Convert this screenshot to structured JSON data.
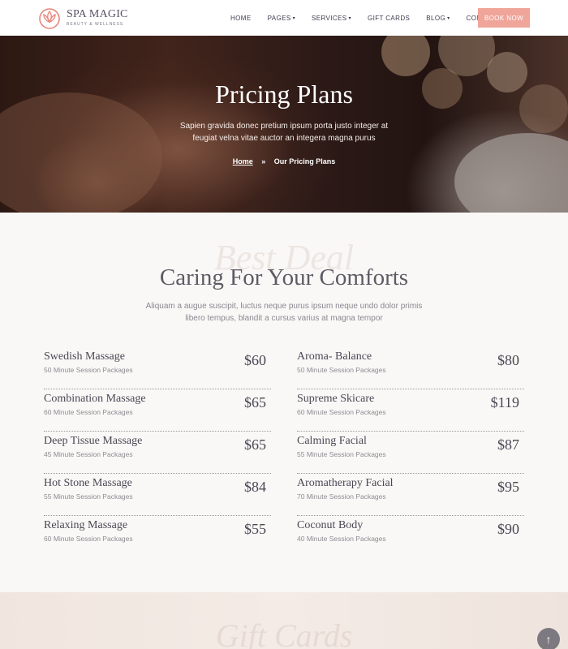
{
  "brand": {
    "name": "SPA MAGIC",
    "tagline": "BEAUTY & WELLNESS",
    "accent_color": "#f0a59a"
  },
  "nav": {
    "items": [
      {
        "label": "HOME",
        "has_dropdown": false
      },
      {
        "label": "PAGES",
        "has_dropdown": true
      },
      {
        "label": "SERVICES",
        "has_dropdown": true
      },
      {
        "label": "GIFT CARDS",
        "has_dropdown": false
      },
      {
        "label": "BLOG",
        "has_dropdown": true
      },
      {
        "label": "CONTACTS",
        "has_dropdown": false
      }
    ],
    "cta": "BOOK NOW"
  },
  "hero": {
    "title": "Pricing Plans",
    "subtitle": "Sapien gravida donec pretium ipsum porta justo integer at feugiat velna vitae auctor an integera magna purus",
    "breadcrumb": {
      "home": "Home",
      "separator": "»",
      "current": "Our Pricing Plans"
    }
  },
  "pricing": {
    "watermark": "Best Deal",
    "title": "Caring For Your Comforts",
    "subtitle": "Aliquam a augue suscipit, luctus neque purus ipsum neque undo dolor primis libero tempus, blandit a cursus varius at magna tempor",
    "left_items": [
      {
        "name": "Swedish Massage",
        "desc": "50 Minute Session Packages",
        "price": "$60"
      },
      {
        "name": "Combination Massage",
        "desc": "60 Minute Session Packages",
        "price": "$65"
      },
      {
        "name": "Deep Tissue Massage",
        "desc": "45 Minute Session Packages",
        "price": "$65"
      },
      {
        "name": "Hot Stone Massage",
        "desc": "55 Minute Session Packages",
        "price": "$84"
      },
      {
        "name": "Relaxing Massage",
        "desc": "60 Minute Session Packages",
        "price": "$55"
      }
    ],
    "right_items": [
      {
        "name": "Aroma- Balance",
        "desc": "50 Minute Session Packages",
        "price": "$80"
      },
      {
        "name": "Supreme Skicare",
        "desc": "60 Minute Session Packages",
        "price": "$119"
      },
      {
        "name": "Calming Facial",
        "desc": "55 Minute Session Packages",
        "price": "$87"
      },
      {
        "name": "Aromatherapy Facial",
        "desc": "70 Minute Session Packages",
        "price": "$95"
      },
      {
        "name": "Coconut Body",
        "desc": "40 Minute Session Packages",
        "price": "$90"
      }
    ]
  },
  "gift_section": {
    "watermark": "Gift Cards"
  },
  "icons": {
    "logo": "lotus-icon",
    "back_to_top": "arrow-up-icon"
  }
}
